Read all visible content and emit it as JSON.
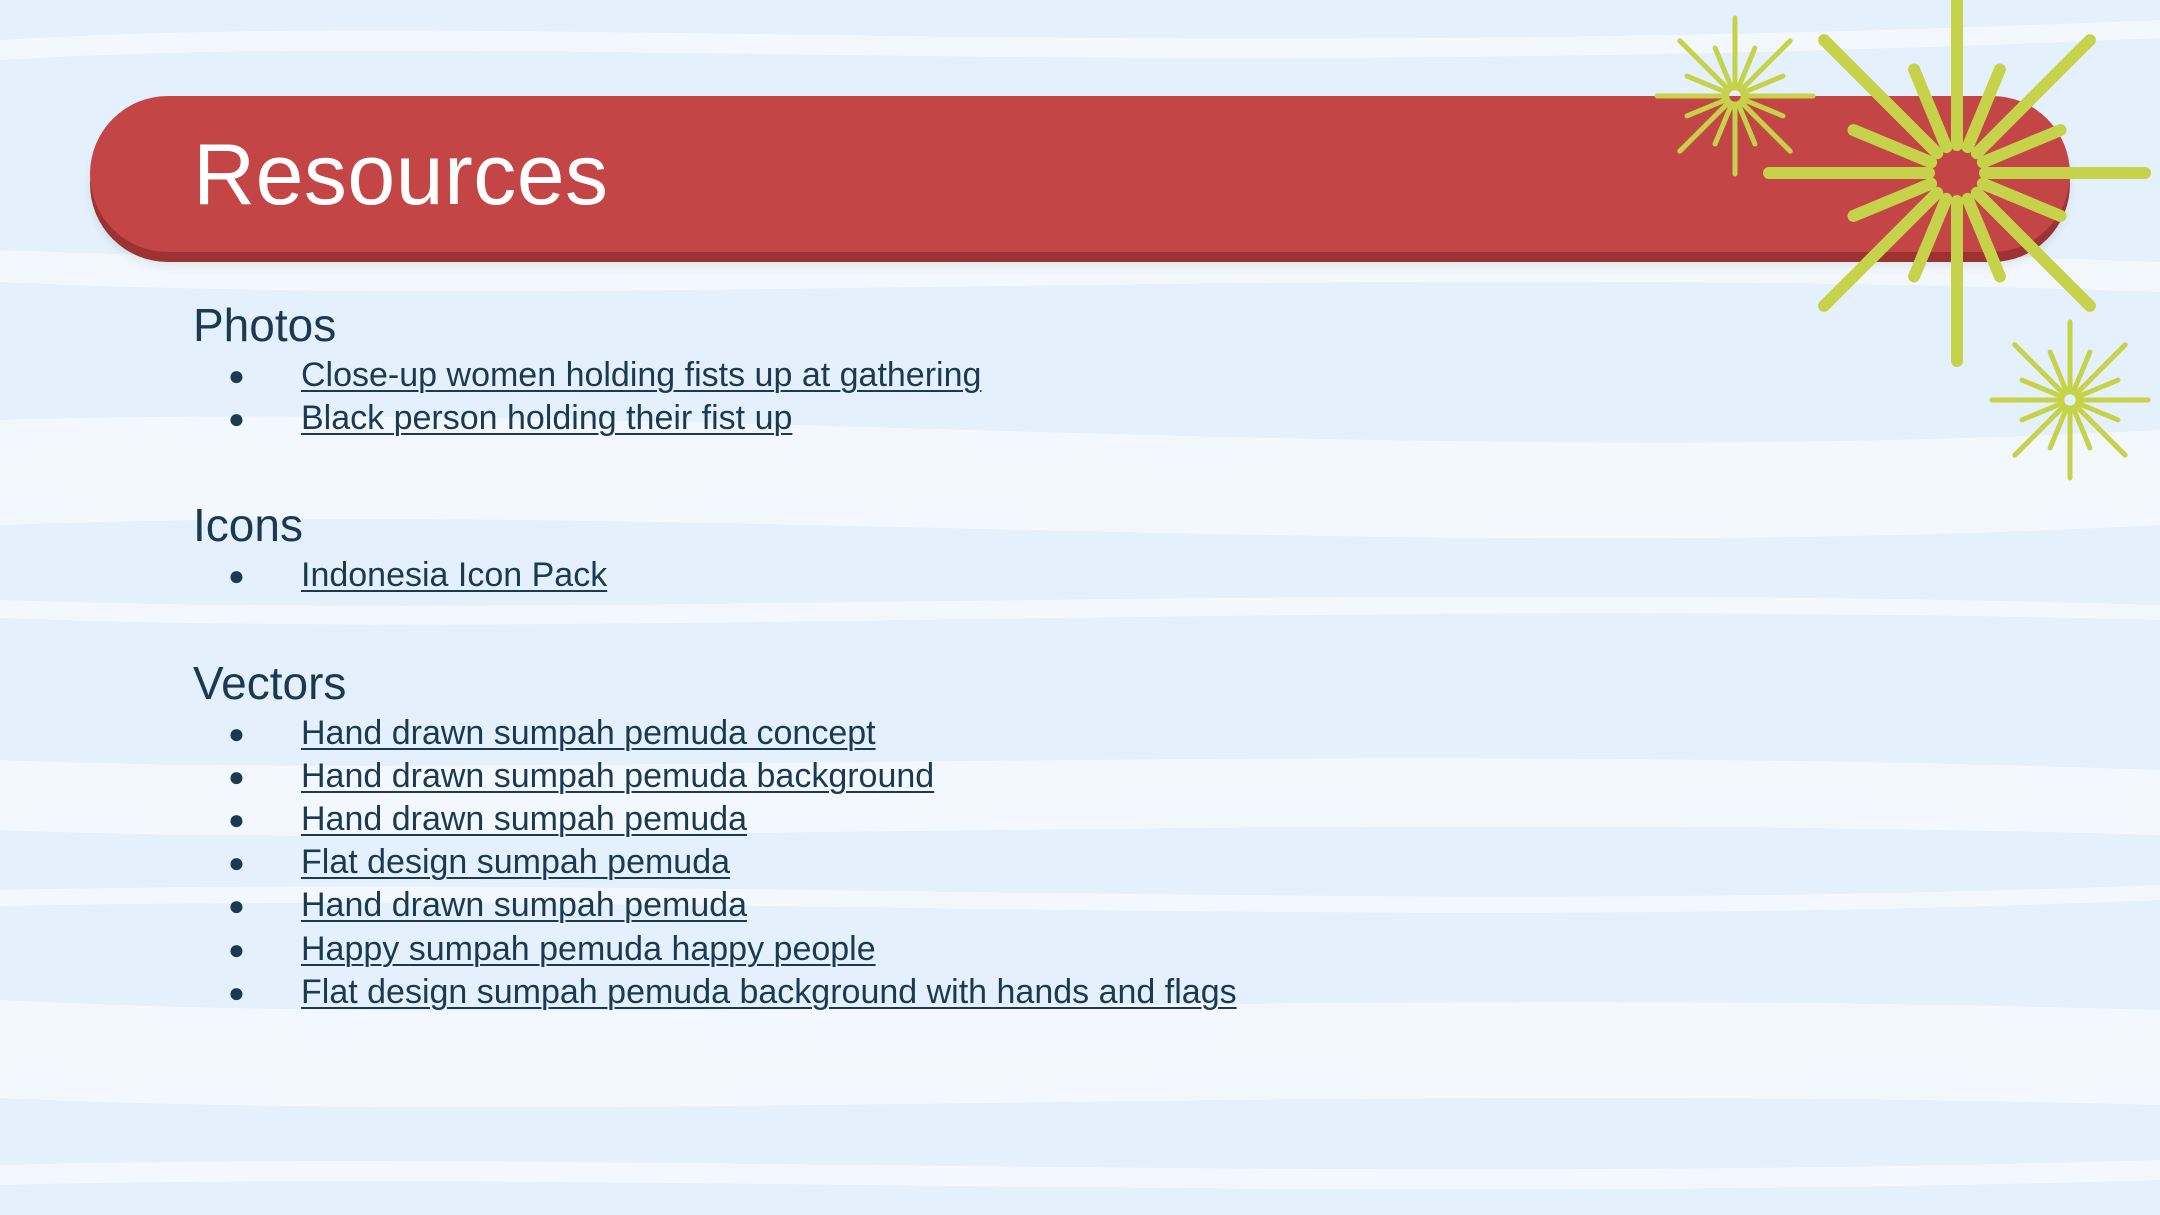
{
  "slide": {
    "title": "Resources",
    "colors": {
      "background": "#e4f0fc",
      "stripe": "#f3f8fe",
      "banner": "#c44545",
      "banner_shadow": "#9c3232",
      "burst": "#c6d34a",
      "text": "#1b3a52"
    },
    "decoration_icon": "starburst-icon"
  },
  "sections": [
    {
      "heading": "Photos",
      "bullet": "●",
      "items": [
        "Close-up women holding fists up at gathering",
        "Black person holding their fist up"
      ]
    },
    {
      "heading": "Icons",
      "bullet": "●",
      "items": [
        "Indonesia Icon Pack"
      ]
    },
    {
      "heading": "Vectors",
      "bullet": "●",
      "items": [
        "Hand drawn sumpah pemuda concept",
        "Hand drawn sumpah pemuda background",
        "Hand drawn sumpah pemuda",
        "Flat design sumpah pemuda",
        "Hand drawn sumpah pemuda",
        "Happy sumpah pemuda happy people",
        "Flat design sumpah pemuda background with hands and flags"
      ]
    }
  ]
}
